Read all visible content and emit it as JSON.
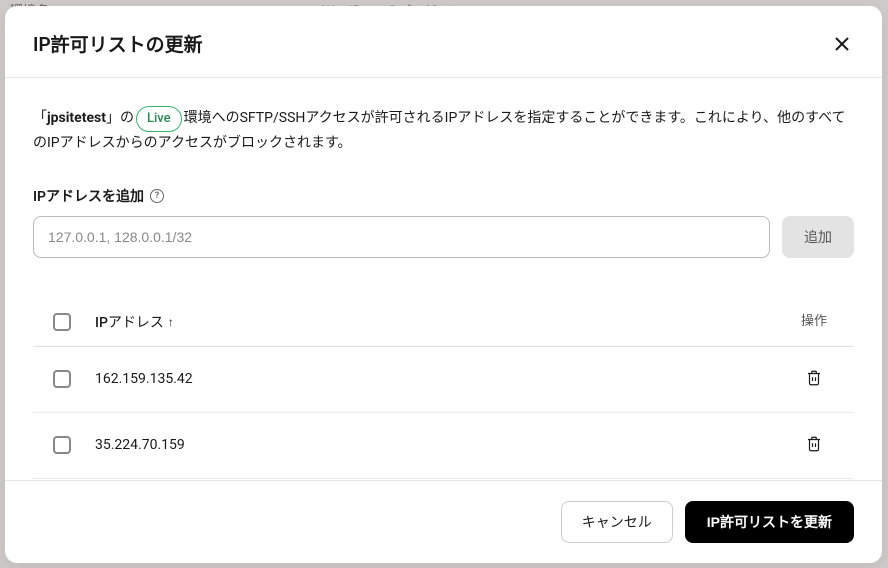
{
  "bg": {
    "left_text": "環境名",
    "center_text": "WordPressのバージョン"
  },
  "modal": {
    "title": "IP許可リストの更新",
    "description": {
      "prefix": "「",
      "site": "jpsitetest",
      "after_site": "」の",
      "badge": "Live",
      "after_badge": "環境へのSFTP/SSHアクセスが許可されるIPアドレスを指定することができます。これにより、他のすべてのIPアドレスからのアクセスがブロックされます。"
    },
    "field_label": "IPアドレスを追加",
    "input_placeholder": "127.0.0.1, 128.0.0.1/32",
    "add_label": "追加",
    "table": {
      "ip_header": "IPアドレス",
      "sort_indicator": "↑",
      "actions_header": "操作",
      "rows": [
        {
          "ip": "162.159.135.42"
        },
        {
          "ip": "35.224.70.159"
        }
      ]
    },
    "footer": {
      "cancel": "キャンセル",
      "submit": "IP許可リストを更新"
    }
  }
}
